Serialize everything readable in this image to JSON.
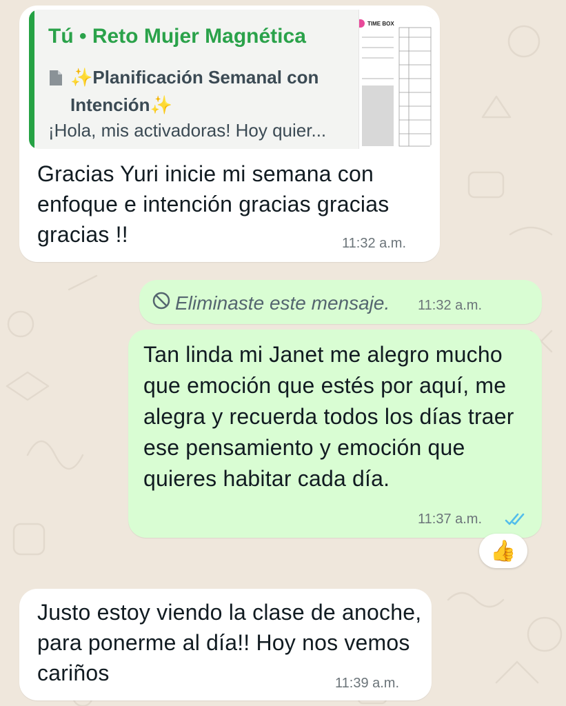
{
  "messages": [
    {
      "quote": {
        "title": "Tú • Reto Mujer Magnética",
        "line2": "✨Planificación Semanal con Intención✨",
        "preview": "¡Hola, mis activadoras! Hoy quier...",
        "thumbnail_label": "TIME BOX",
        "icon": "document-icon"
      },
      "text": "Gracias Yuri inicie mi semana con enfoque e intención gracias gracias gracias !!",
      "time": "11:32 a.m."
    },
    {
      "deleted_text": "Eliminaste este mensaje.",
      "icon": "blocked-icon",
      "time": "11:32 a.m."
    },
    {
      "text": "Tan linda mi Janet me alegro mucho que emoción que estés por aquí, me alegra y recuerda todos los días traer ese pensamiento y emoción que quieres habitar cada día.",
      "time": "11:37 a.m.",
      "status_icon": "double-check-read-icon",
      "reaction": "👍"
    },
    {
      "text": "Justo estoy viendo la clase de anoche, para ponerme al día!! Hoy nos vemos cariños",
      "time": "11:39 a.m."
    }
  ],
  "colors": {
    "wallpaper": "#efe7dc",
    "incoming_bubble": "#ffffff",
    "outgoing_bubble": "#d9fdd3",
    "quote_accent": "#25a244",
    "read_ticks": "#53bdeb"
  }
}
